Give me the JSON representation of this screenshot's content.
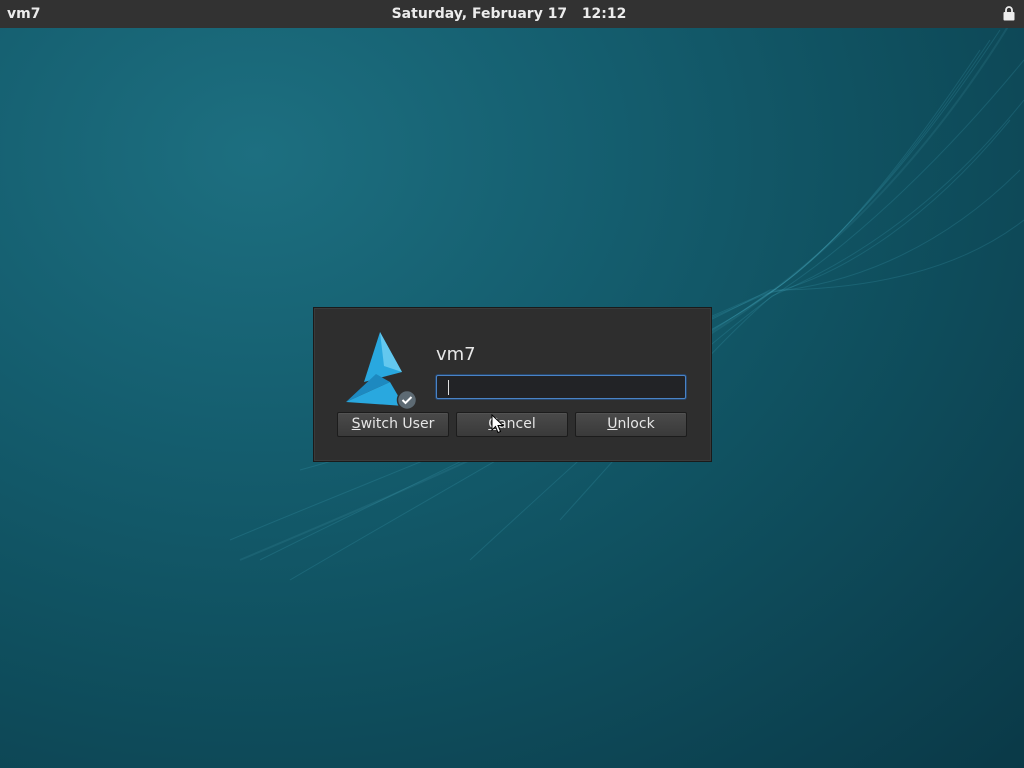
{
  "topbar": {
    "hostname": "vm7",
    "date": "Saturday, February 17",
    "time": "12:12",
    "lock_icon": "lock-icon"
  },
  "dialog": {
    "username": "vm7",
    "password_value": "",
    "buttons": [
      {
        "mnemonic": "S",
        "rest": "witch User"
      },
      {
        "mnemonic": "C",
        "rest": "ancel"
      },
      {
        "mnemonic": "U",
        "rest": "nlock"
      }
    ],
    "logo_icon": "distro-logo-icon",
    "badge_icon": "checkmark-badge-icon"
  },
  "colors": {
    "topbar_bg": "#323232",
    "dialog_bg": "#2e2e2e",
    "accent": "#4a83c6",
    "logo_blue": "#29a8df",
    "wallpaper": "#135868"
  }
}
